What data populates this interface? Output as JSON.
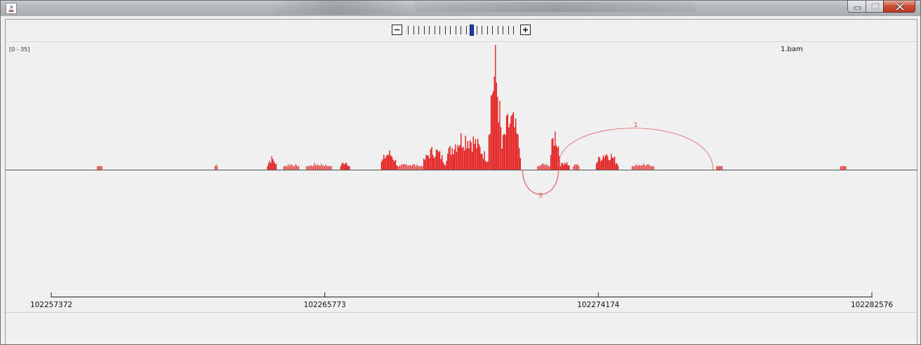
{
  "window": {
    "title": "",
    "icon": "java-icon",
    "controls": [
      "minimize-icon",
      "maximize-icon",
      "close-icon"
    ]
  },
  "zoom": {
    "out_icon": "minus-icon",
    "in_icon": "plus-icon",
    "level_count": 21,
    "current_level": 12
  },
  "track": {
    "name": "1.bam",
    "data_range": "[0 - 35]",
    "color": "#e31b1b",
    "junction_color": "#e36060"
  },
  "genomic_axis": {
    "ticks": [
      "102257372",
      "102265773",
      "102274174",
      "102282576"
    ]
  },
  "chart_data": {
    "type": "bar",
    "title": "",
    "ylim": [
      0,
      35
    ],
    "x_start": 102257372,
    "x_end": 102282576,
    "coverage_clusters": [
      {
        "start": 102258780,
        "end": 102258950,
        "height": 1
      },
      {
        "start": 102262390,
        "end": 102262500,
        "height": 2
      },
      {
        "start": 102264000,
        "end": 102264300,
        "height": 4
      },
      {
        "start": 102264500,
        "end": 102265000,
        "height": 2
      },
      {
        "start": 102265200,
        "end": 102266000,
        "height": 2
      },
      {
        "start": 102266250,
        "end": 102266550,
        "height": 3
      },
      {
        "start": 102267500,
        "end": 102268000,
        "height": 6
      },
      {
        "start": 102268000,
        "end": 102268800,
        "height": 2
      },
      {
        "start": 102268800,
        "end": 102269500,
        "height": 7
      },
      {
        "start": 102269500,
        "end": 102270800,
        "height": 12
      },
      {
        "start": 102270800,
        "end": 102271200,
        "height": 35
      },
      {
        "start": 102271200,
        "end": 102271800,
        "height": 18
      },
      {
        "start": 102272300,
        "end": 102272700,
        "height": 2
      },
      {
        "start": 102272700,
        "end": 102273000,
        "height": 13
      },
      {
        "start": 102273000,
        "end": 102273300,
        "height": 3
      },
      {
        "start": 102273400,
        "end": 102273600,
        "height": 2
      },
      {
        "start": 102274100,
        "end": 102274800,
        "height": 6
      },
      {
        "start": 102275200,
        "end": 102275900,
        "height": 2
      },
      {
        "start": 102277800,
        "end": 102278000,
        "height": 1
      },
      {
        "start": 102281600,
        "end": 102281800,
        "height": 1
      }
    ],
    "junctions": [
      {
        "start": 102271850,
        "end": 102272950,
        "count": "3",
        "strand": "minus"
      },
      {
        "start": 102272950,
        "end": 102277700,
        "count": "1",
        "strand": "plus"
      }
    ]
  }
}
